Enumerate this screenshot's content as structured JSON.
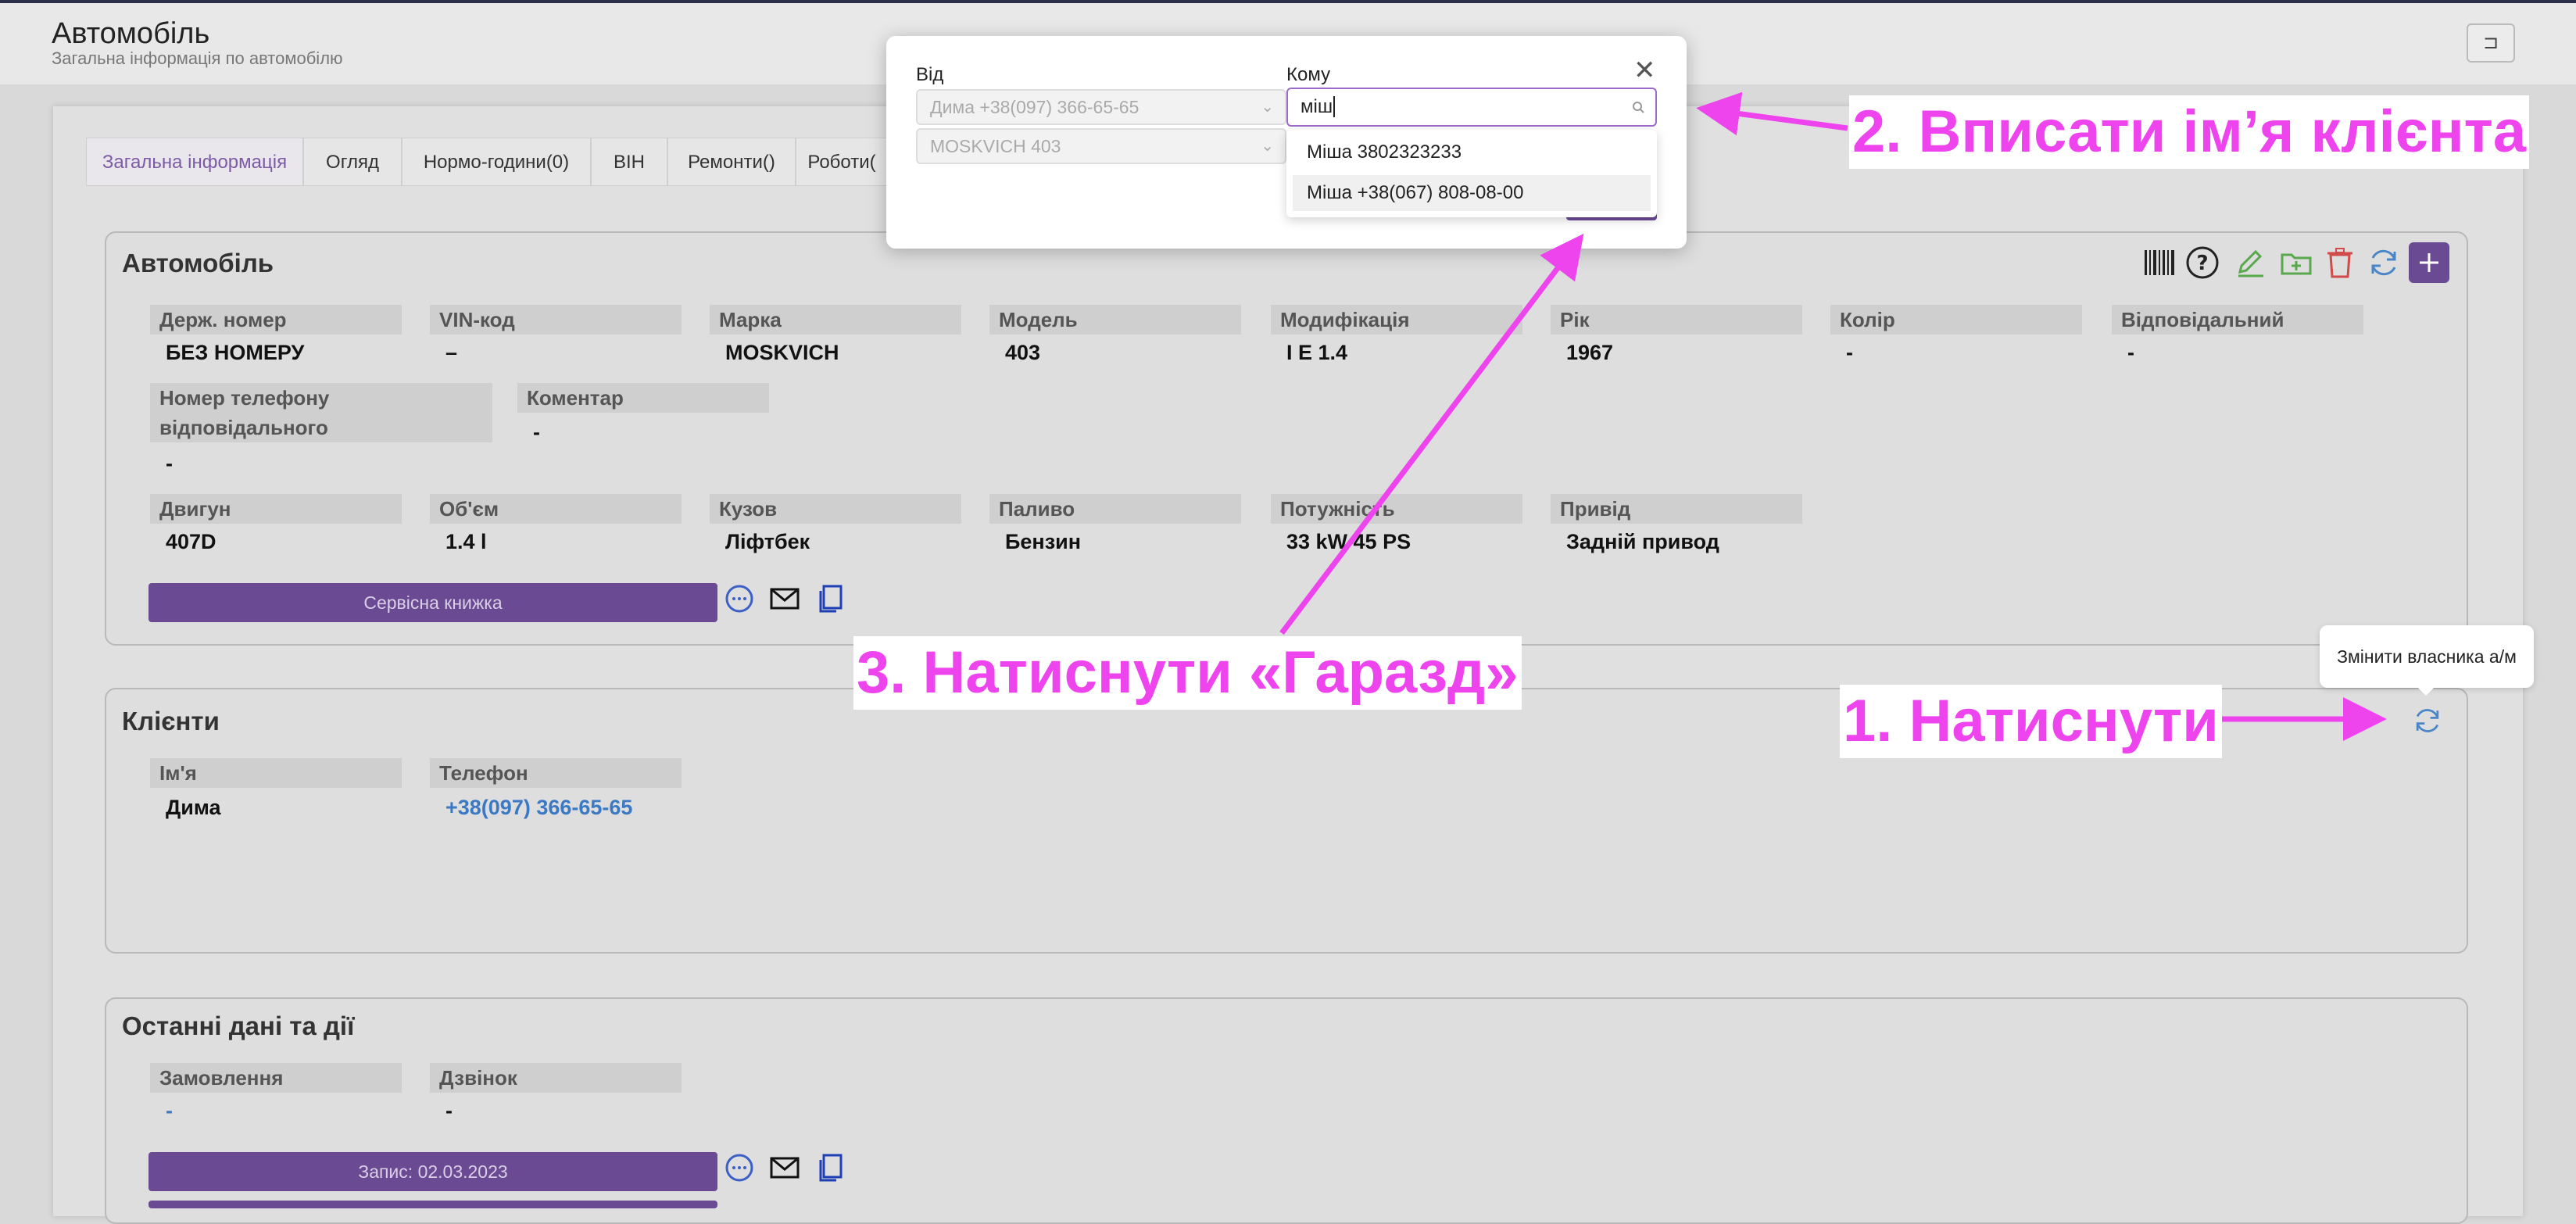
{
  "header": {
    "title": "Автомобіль",
    "subtitle": "Загальна інформація по автомобілю",
    "exit_icon": "⊐"
  },
  "tabs": [
    {
      "label": "Загальна інформація",
      "active": true
    },
    {
      "label": "Огляд"
    },
    {
      "label": "Нормо-години(0)"
    },
    {
      "label": "ВІН"
    },
    {
      "label": "Ремонти()"
    },
    {
      "label": "Роботи("
    }
  ],
  "car_card": {
    "title": "Автомобіль",
    "fields_row1": [
      {
        "label": "Держ. номер",
        "value": "БЕЗ НОМЕРУ"
      },
      {
        "label": "VIN-код",
        "value": "–"
      },
      {
        "label": "Марка",
        "value": "MOSKVICH"
      },
      {
        "label": "Модель",
        "value": "403"
      },
      {
        "label": "Модифікація",
        "value": "I E 1.4"
      },
      {
        "label": "Рік",
        "value": "1967"
      },
      {
        "label": "Колір",
        "value": "-"
      },
      {
        "label": "Відповідальний",
        "value": "-"
      }
    ],
    "phone_label_1": "Номер телефону",
    "phone_label_2": "відповідального",
    "phone_value": "-",
    "comment_label": "Коментар",
    "comment_value": "-",
    "fields_row3": [
      {
        "label": "Двигун",
        "value": "407D"
      },
      {
        "label": "Об'єм",
        "value": "1.4 l"
      },
      {
        "label": "Кузов",
        "value": "Ліфтбек"
      },
      {
        "label": "Паливо",
        "value": "Бензин"
      },
      {
        "label": "Потужність",
        "value": "33 kW 45 PS"
      },
      {
        "label": "Привід",
        "value": "Задній привод"
      }
    ],
    "service_book_button": "Сервісна книжка"
  },
  "clients_card": {
    "title": "Клієнти",
    "name_label": "Ім'я",
    "name_value": "Дима",
    "phone_label": "Телефон",
    "phone_value": "+38(097) 366-65-65"
  },
  "recent_card": {
    "title": "Останні дані та дії",
    "order_label": "Замовлення",
    "order_value": "-",
    "call_label": "Дзвінок",
    "call_value": "-",
    "record_button": "Запис: 02.03.2023"
  },
  "modal": {
    "from_label": "Від",
    "to_label": "Кому",
    "from_client": "Дима +38(097) 366-65-65",
    "from_car": "MOSKVICH 403",
    "to_input_value": "міш",
    "options": [
      "Міша 3802323233",
      "Міша +38(067) 808-08-00"
    ]
  },
  "tooltip": {
    "text": "Змінити власника а/м"
  },
  "annotations": {
    "step1": "1. Натиснути",
    "step2": "2. Вписати ім’я клієнта",
    "step3": "3. Натиснути «Гаразд»"
  },
  "icons": {
    "barcode": "barcode-icon",
    "help": "help-icon",
    "edit": "edit-icon",
    "add_folder": "add-folder-icon",
    "delete": "trash-icon",
    "refresh": "refresh-icon",
    "add": "plus-icon",
    "chat": "chat-icon",
    "mail": "mail-icon",
    "copy": "copy-icon",
    "close": "close-icon",
    "search": "search-icon",
    "chevron": "chevron-down-icon"
  },
  "colors": {
    "accent": "#6a4a93",
    "annotation": "#ee44ee",
    "link": "#3b79c4"
  }
}
